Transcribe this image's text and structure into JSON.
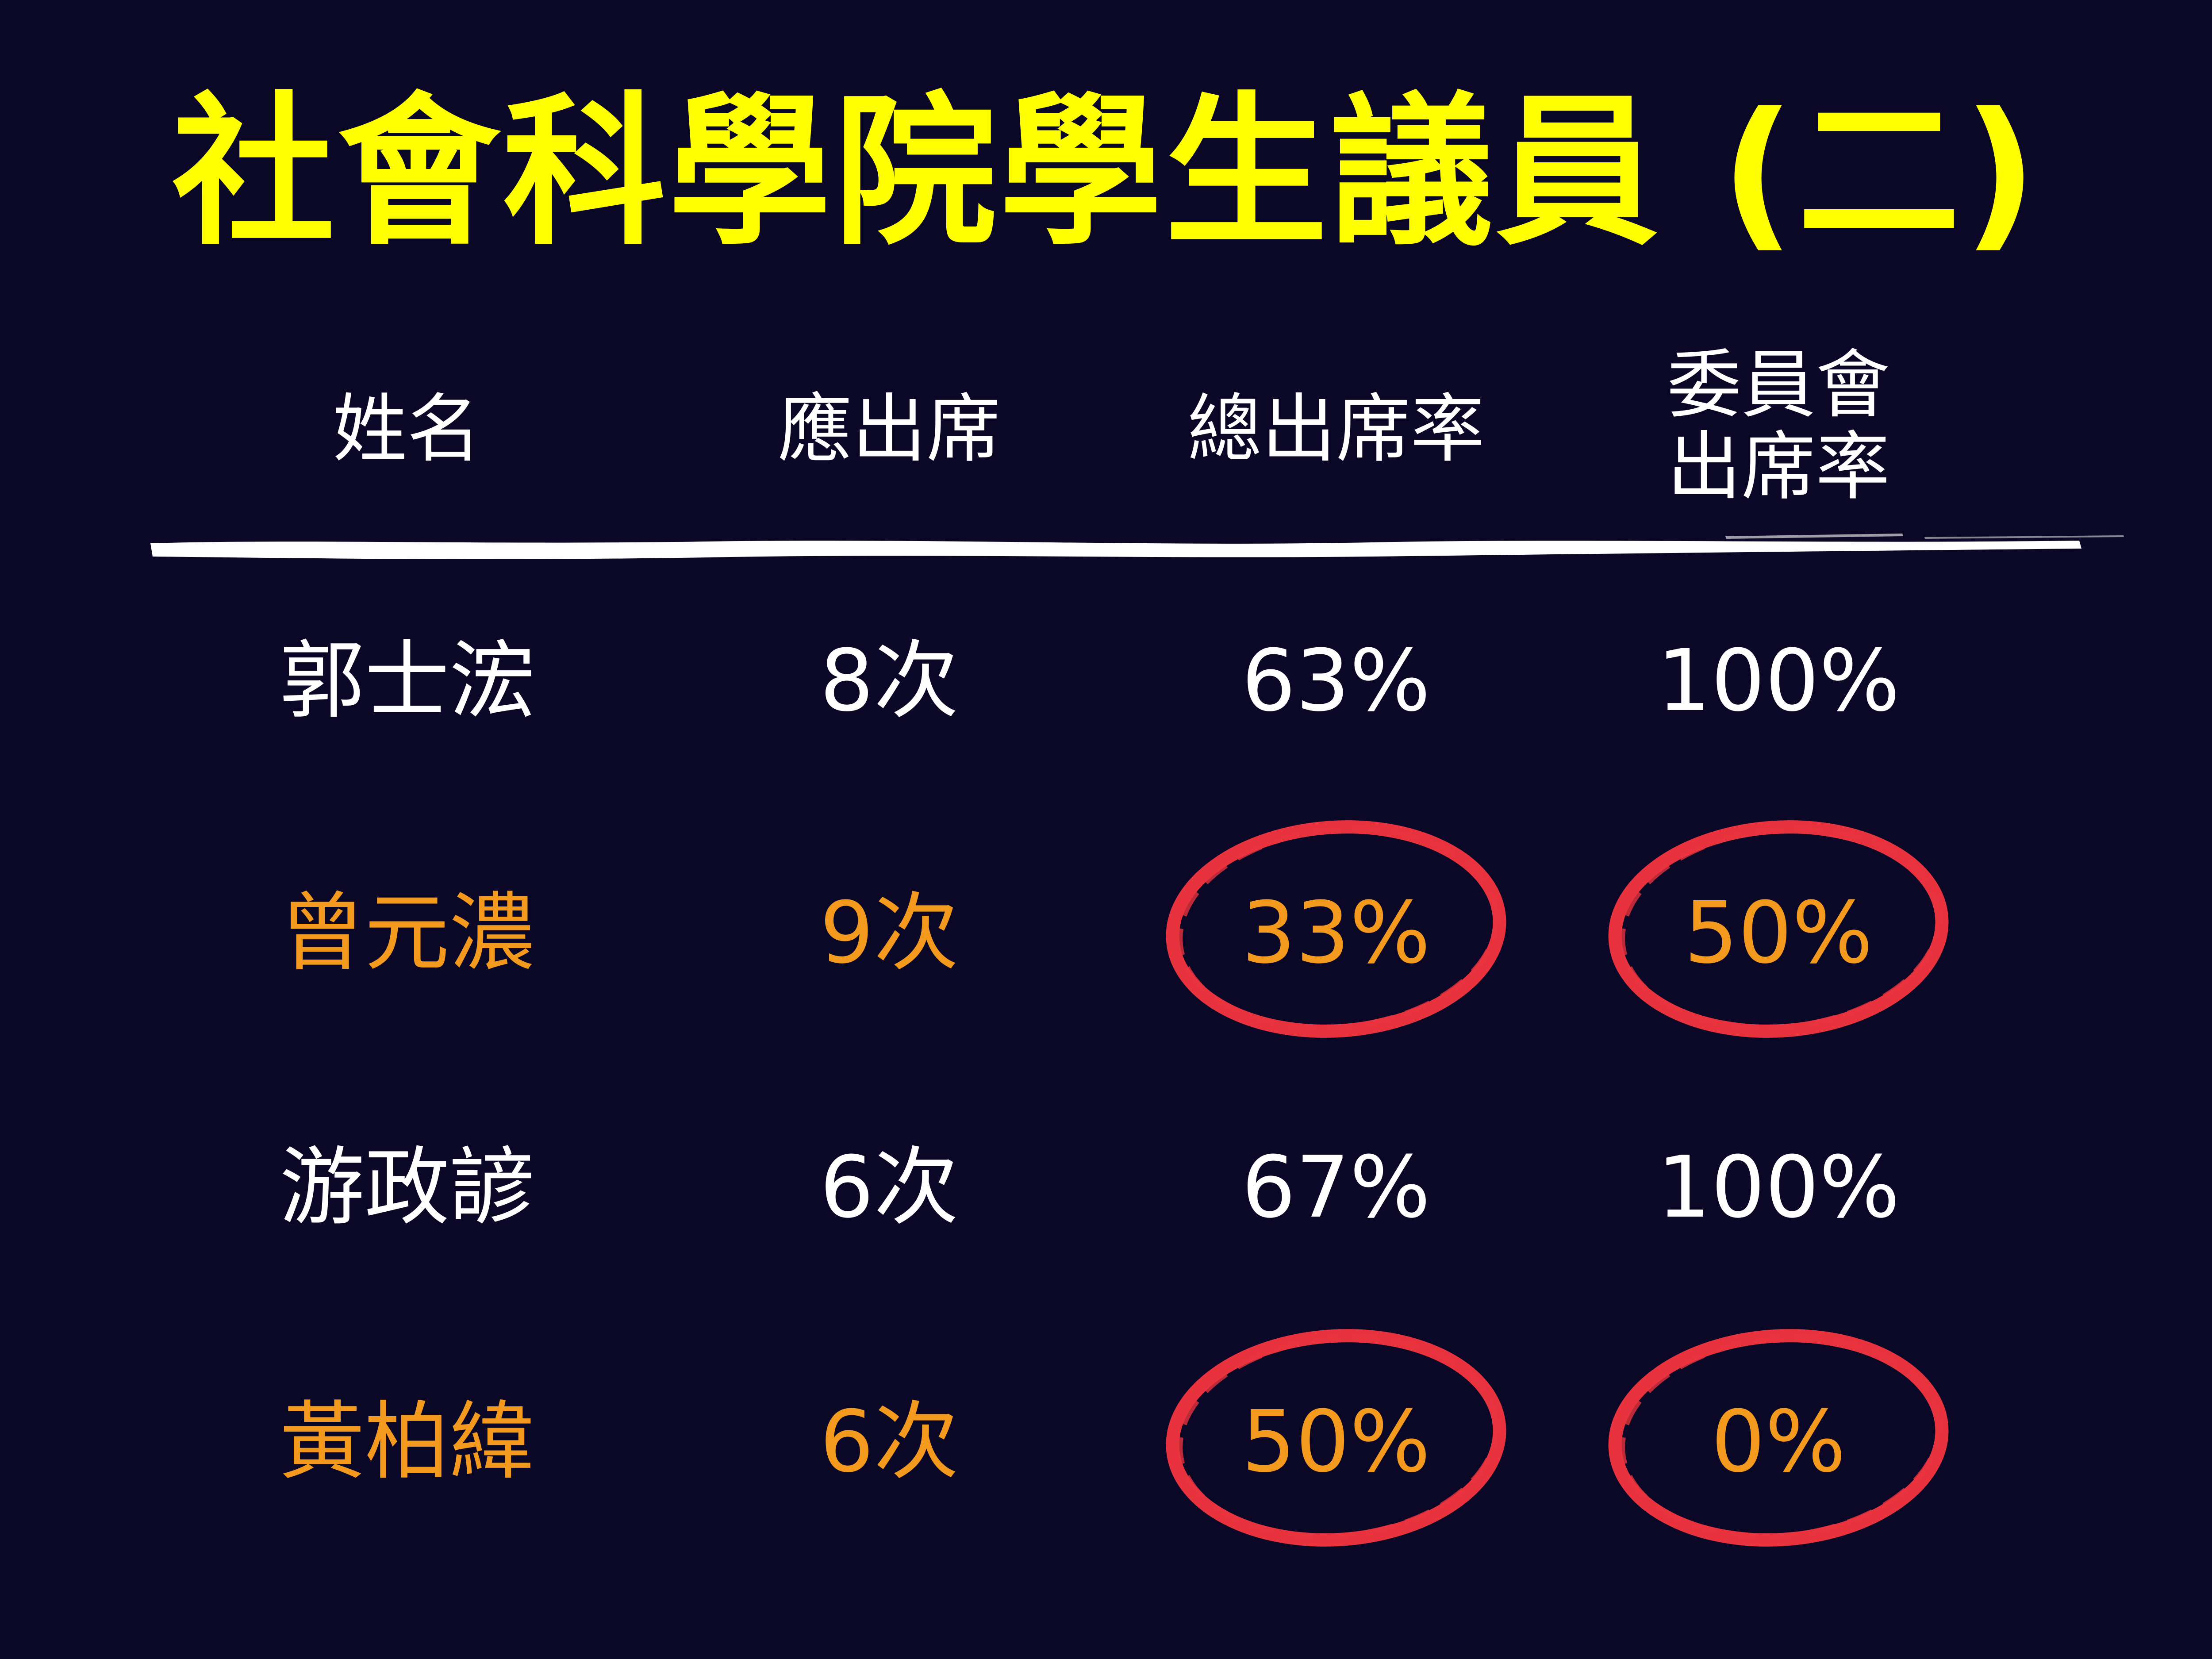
{
  "slide": {
    "title": "社會科學院學生議員 (二)"
  },
  "table": {
    "headers": {
      "name": "姓名",
      "expected": "應出席",
      "overall": "總出席率",
      "committee_line1": "委員會",
      "committee_line2": "出席率"
    },
    "rows": [
      {
        "name": "郭士浤",
        "expected": "8次",
        "overall": "63%",
        "committee": "100%",
        "highlighted": false
      },
      {
        "name": "曾元濃",
        "expected": "9次",
        "overall": "33%",
        "committee": "50%",
        "highlighted": true
      },
      {
        "name": "游政諺",
        "expected": "6次",
        "overall": "67%",
        "committee": "100%",
        "highlighted": false
      },
      {
        "name": "黃柏緯",
        "expected": "6次",
        "overall": "50%",
        "committee": "0%",
        "highlighted": true
      }
    ]
  },
  "colors": {
    "background": "#0a0826",
    "title": "#ffff00",
    "normal_text": "#ffffff",
    "highlight_text": "#f39a1e",
    "circle": "#e8333f",
    "divider": "#ffffff"
  }
}
